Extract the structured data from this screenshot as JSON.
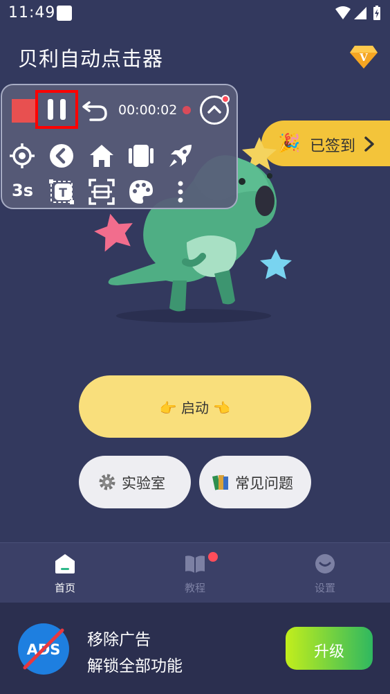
{
  "status_bar": {
    "time": "11:49",
    "icons": [
      "notification-square-icon",
      "wifi-icon",
      "signal-icon",
      "battery-charging-icon"
    ]
  },
  "header": {
    "title": "贝利自动点击器",
    "vip_icon": "vip-diamond-icon"
  },
  "signin": {
    "icon": "party-popper-icon",
    "label": "已签到"
  },
  "floating_panel": {
    "timer": "00:00:02",
    "delay_label": "3s",
    "row1_icons": [
      "stop-icon",
      "pause-icon",
      "undo-icon",
      "recording-dot-icon",
      "collapse-up-icon"
    ],
    "row2_icons": [
      "target-icon",
      "back-icon",
      "home-icon",
      "recents-icon",
      "rocket-icon"
    ],
    "row3_icons": [
      "text-recognition-icon",
      "scan-icon",
      "palette-icon",
      "more-vertical-icon"
    ]
  },
  "main": {
    "start_button": {
      "label": "启动",
      "left_emoji": "👉",
      "right_emoji": "👈"
    },
    "lab_button": {
      "label": "实验室",
      "icon": "gear-icon"
    },
    "faq_button": {
      "label": "常见问题",
      "icon": "books-icon"
    }
  },
  "bottom_nav": {
    "items": [
      {
        "label": "首页",
        "icon": "home-tab-icon",
        "active": true
      },
      {
        "label": "教程",
        "icon": "book-icon",
        "active": false,
        "badge": true
      },
      {
        "label": "设置",
        "icon": "smile-icon",
        "active": false
      }
    ],
    "active_color": "#ffffff",
    "inactive_color": "#7c80a3"
  },
  "ad_banner": {
    "logo_text": "ADS",
    "title": "移除广告",
    "subtitle": "解锁全部功能",
    "button_label": "升级"
  },
  "colors": {
    "background": "#33395e",
    "accent_yellow": "#f9df7c",
    "signin_yellow": "#f3c43a",
    "highlight_red": "#ff0000",
    "upgrade_gradient_start": "#c2ee1c",
    "upgrade_gradient_end": "#2fb860"
  }
}
